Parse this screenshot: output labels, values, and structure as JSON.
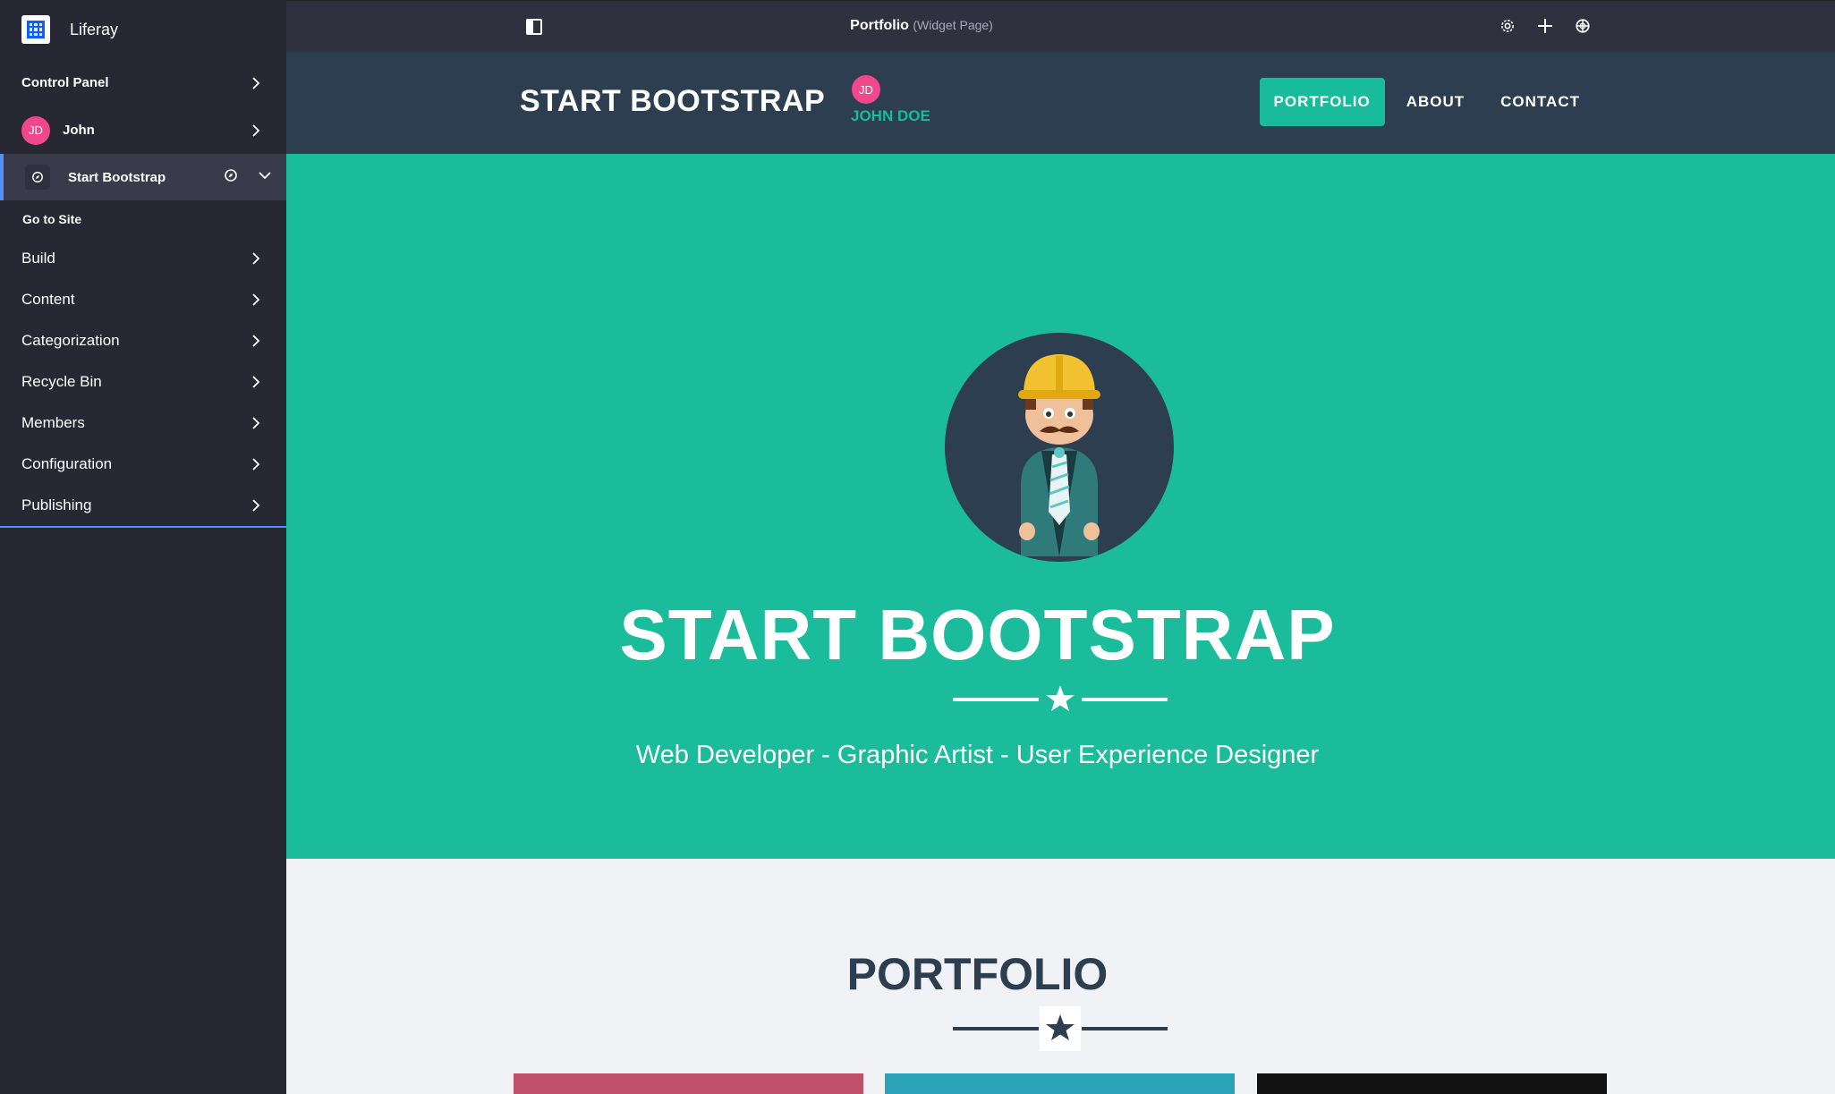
{
  "sidebar": {
    "brand": "Liferay",
    "control_panel": "Control Panel",
    "user": {
      "initials": "JD",
      "name": "John"
    },
    "site": {
      "name": "Start Bootstrap"
    },
    "go_to_site": "Go to Site",
    "categories": [
      {
        "label": "Build"
      },
      {
        "label": "Content"
      },
      {
        "label": "Categorization"
      },
      {
        "label": "Recycle Bin"
      },
      {
        "label": "Members"
      },
      {
        "label": "Configuration"
      },
      {
        "label": "Publishing"
      }
    ]
  },
  "control_menu": {
    "page_title": "Portfolio",
    "page_type": "(Widget Page)",
    "icons": [
      "gear-icon",
      "plus-icon",
      "simulation-icon"
    ]
  },
  "navbar": {
    "brand": "START BOOTSTRAP",
    "user_initials": "JD",
    "user_name": "JOHN DOE",
    "links": [
      {
        "label": "PORTFOLIO",
        "active": true
      },
      {
        "label": "ABOUT",
        "active": false
      },
      {
        "label": "CONTACT",
        "active": false
      }
    ]
  },
  "hero": {
    "title": "START BOOTSTRAP",
    "subtitle": "Web Developer - Graphic Artist - User Experience Designer"
  },
  "portfolio": {
    "title": "PORTFOLIO",
    "card_colors": [
      "#c0506a",
      "#2aa3b8",
      "#111111"
    ]
  },
  "colors": {
    "accent": "#18bc9c",
    "primary_dark": "#2c3e50",
    "sidebar_bg": "#272833",
    "liferay_blue": "#0b5fff",
    "avatar_pink": "#f1478c"
  }
}
